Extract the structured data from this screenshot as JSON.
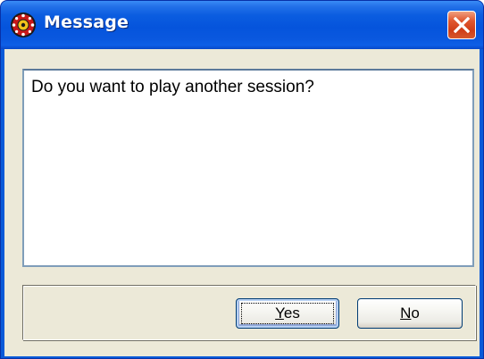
{
  "window": {
    "title": "Message",
    "icon": "roulette-wheel-icon",
    "close_icon": "close-icon"
  },
  "message": {
    "text": "Do you want to play another session?"
  },
  "buttons": {
    "yes_label_mnemonic": "Y",
    "yes_label_rest": "es",
    "no_label_mnemonic": "N",
    "no_label_rest": "o"
  },
  "colors": {
    "titlebar": "#0554dc",
    "close_button": "#d6582f",
    "client_background": "#ece9d8",
    "message_border": "#7f9db9"
  }
}
